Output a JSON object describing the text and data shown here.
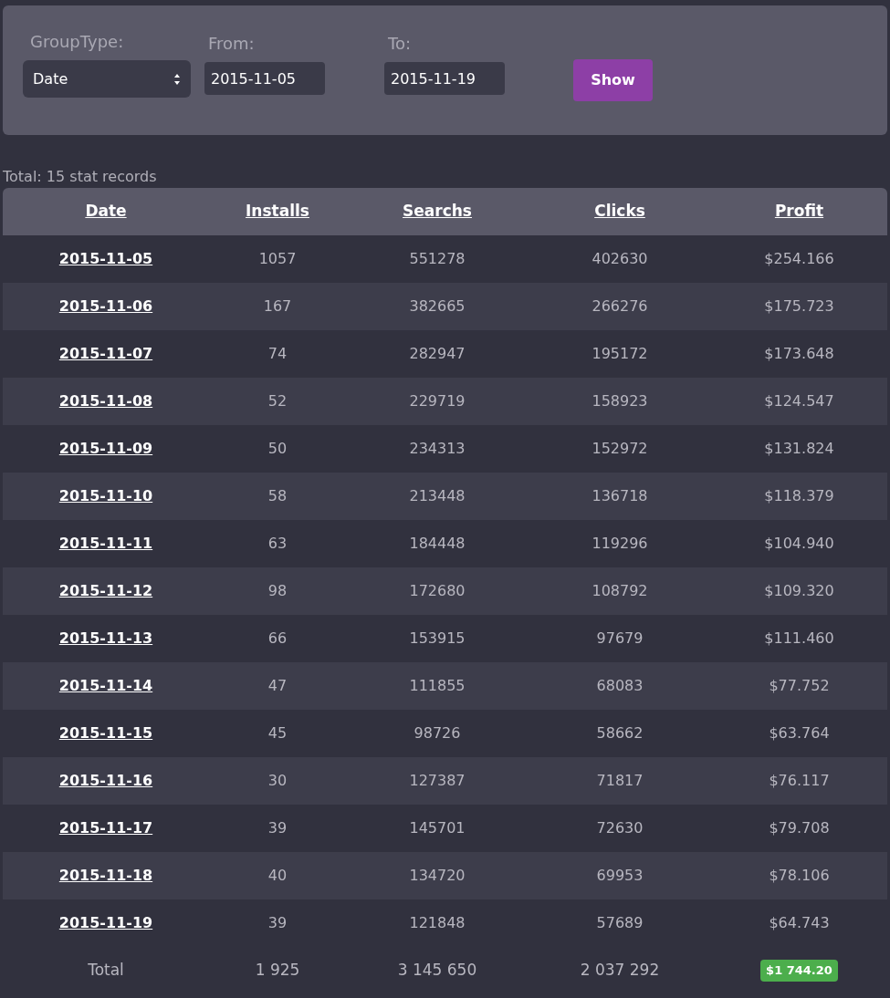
{
  "filters": {
    "group_type": {
      "label": "GroupType:",
      "value": "Date"
    },
    "from": {
      "label": "From:",
      "value": "2015-11-05"
    },
    "to": {
      "label": "To:",
      "value": "2015-11-19"
    },
    "button": "Show"
  },
  "summary": "Total: 15 stat records",
  "table": {
    "columns": [
      "Date",
      "Installs",
      "Searchs",
      "Clicks",
      "Profit"
    ],
    "rows": [
      [
        "2015-11-05",
        "1057",
        "551278",
        "402630",
        "$254.166"
      ],
      [
        "2015-11-06",
        "167",
        "382665",
        "266276",
        "$175.723"
      ],
      [
        "2015-11-07",
        "74",
        "282947",
        "195172",
        "$173.648"
      ],
      [
        "2015-11-08",
        "52",
        "229719",
        "158923",
        "$124.547"
      ],
      [
        "2015-11-09",
        "50",
        "234313",
        "152972",
        "$131.824"
      ],
      [
        "2015-11-10",
        "58",
        "213448",
        "136718",
        "$118.379"
      ],
      [
        "2015-11-11",
        "63",
        "184448",
        "119296",
        "$104.940"
      ],
      [
        "2015-11-12",
        "98",
        "172680",
        "108792",
        "$109.320"
      ],
      [
        "2015-11-13",
        "66",
        "153915",
        "97679",
        "$111.460"
      ],
      [
        "2015-11-14",
        "47",
        "111855",
        "68083",
        "$77.752"
      ],
      [
        "2015-11-15",
        "45",
        "98726",
        "58662",
        "$63.764"
      ],
      [
        "2015-11-16",
        "30",
        "127387",
        "71817",
        "$76.117"
      ],
      [
        "2015-11-17",
        "39",
        "145701",
        "72630",
        "$79.708"
      ],
      [
        "2015-11-18",
        "40",
        "134720",
        "69953",
        "$78.106"
      ],
      [
        "2015-11-19",
        "39",
        "121848",
        "57689",
        "$64.743"
      ]
    ],
    "total": [
      "Total",
      "1 925",
      "3 145 650",
      "2 037 292",
      "$1 744.20"
    ]
  }
}
